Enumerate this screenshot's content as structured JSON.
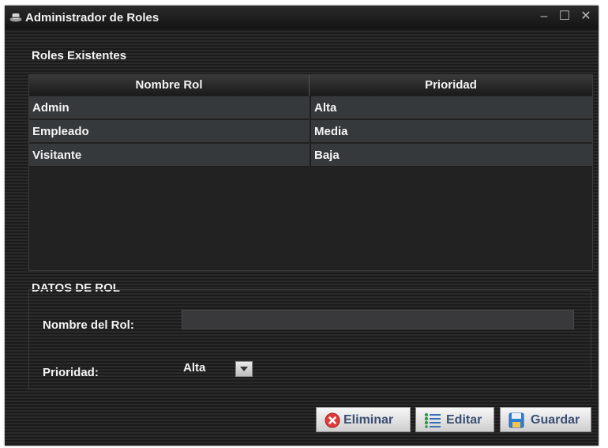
{
  "window": {
    "title": "Administrador de Roles",
    "controls": {
      "minimize": "–",
      "maximize": "☐",
      "close": "✕"
    }
  },
  "roles_section": {
    "label": "Roles Existentes",
    "columns": [
      "Nombre Rol",
      "Prioridad"
    ],
    "rows": [
      [
        "Admin",
        "Alta"
      ],
      [
        "Empleado",
        "Media"
      ],
      [
        "Visitante",
        "Baja"
      ]
    ]
  },
  "data_section": {
    "label": "DATOS DE ROL",
    "name_label": "Nombre del Rol:",
    "name_value": "",
    "priority_label": "Prioridad:",
    "priority_value": "Alta"
  },
  "actions": {
    "eliminar": "Eliminar",
    "editar": "Editar",
    "guardar": "Guardar"
  },
  "icons": {
    "app": "hat-icon",
    "eliminar": "delete-icon",
    "editar": "list-icon",
    "guardar": "save-icon"
  },
  "colors": {
    "background": "#1b1b1b",
    "row": "#36393b",
    "button_text": "#3a4f72",
    "delete": "#e03b3b"
  }
}
